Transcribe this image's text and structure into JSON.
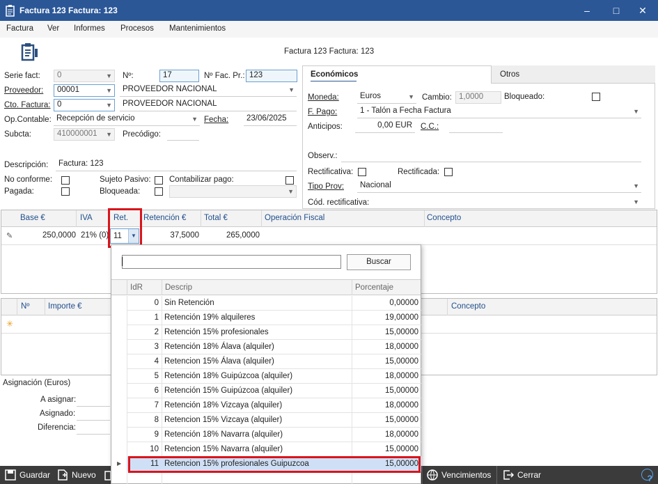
{
  "window": {
    "title": "Factura 123  Factura: 123",
    "minimize": "–",
    "maximize": "□",
    "close": "✕"
  },
  "menu": [
    "Factura",
    "Ver",
    "Informes",
    "Procesos",
    "Mantenimientos"
  ],
  "header": {
    "doc_title": "Factura 123  Factura: 123"
  },
  "form": {
    "serie_label": "Serie fact:",
    "serie_value": "0",
    "num_label": "Nº:",
    "num_value": "17",
    "numfac_label": "Nº Fac. Pr.:",
    "numfac_value": "123",
    "proveedor_label": "Proveedor:",
    "proveedor_code": "00001",
    "proveedor_name": "PROVEEDOR NACIONAL",
    "cto_label": "Cto. Factura:",
    "cto_code": "0",
    "cto_name": "PROVEEDOR NACIONAL",
    "opcontable_label": "Op.Contable:",
    "opcontable_value": "Recepción de servicio",
    "fecha_label": "Fecha:",
    "fecha_value": "23/06/2025",
    "subcta_label": "Subcta:",
    "subcta_value": "410000001",
    "precodigo_label": "Precódigo:",
    "precodigo_value": "",
    "descripcion_label": "Descripción:",
    "descripcion_value": "Factura: 123",
    "noconforme_label": "No conforme:",
    "sujeto_label": "Sujeto Pasivo:",
    "contabilizar_label": "Contabilizar pago:",
    "pagada_label": "Pagada:",
    "bloqueada_label": "Bloqueada:"
  },
  "tabs": {
    "economicos": "Económicos",
    "otros": "Otros"
  },
  "economicos": {
    "moneda_label": "Moneda:",
    "moneda_value": "Euros",
    "cambio_label": "Cambio:",
    "cambio_value": "1,0000",
    "bloqueado_label": "Bloqueado:",
    "fpago_label": "F. Pago:",
    "fpago_value": "1 - Talón a Fecha Factura",
    "anticipos_label": "Anticipos:",
    "anticipos_value": "0,00 EUR",
    "cc_label": "C.C.:",
    "cc_value": "",
    "observ_label": "Observ.:",
    "rectificativa_label": "Rectificativa:",
    "rectificada_label": "Rectificada:",
    "tipoprov_label": "Tipo Prov:",
    "tipoprov_value": "Nacional",
    "codrect_label": "Cód. rectificativa:"
  },
  "grid1": {
    "columns": [
      "Base €",
      "IVA",
      "Ret.",
      "Retención €",
      "Total €",
      "Operación Fiscal",
      "Concepto"
    ],
    "row": {
      "base": "250,0000",
      "iva": "21% (0)",
      "ret": "11",
      "retencion": "37,5000",
      "total": "265,0000"
    }
  },
  "grid2": {
    "columns": [
      "Nº",
      "Importe €",
      "Concepto"
    ]
  },
  "asignacion": {
    "title": "Asignación (Euros)",
    "a_asignar": "A asignar:",
    "asignado": "Asignado:",
    "diferencia": "Diferencia:"
  },
  "popup": {
    "search_value": "",
    "search_button": "Buscar",
    "columns": [
      "IdR",
      "Descrip",
      "Porcentaje"
    ],
    "rows": [
      {
        "idr": "0",
        "desc": "Sin Retención",
        "pct": "0,00000"
      },
      {
        "idr": "1",
        "desc": "Retención 19% alquileres",
        "pct": "19,00000"
      },
      {
        "idr": "2",
        "desc": "Retención 15% profesionales",
        "pct": "15,00000"
      },
      {
        "idr": "3",
        "desc": "Retención 18% Álava (alquiler)",
        "pct": "18,00000"
      },
      {
        "idr": "4",
        "desc": "Retencion 15% Álava (alquiler)",
        "pct": "15,00000"
      },
      {
        "idr": "5",
        "desc": "Retención 18% Guipúzcoa (alquiler)",
        "pct": "18,00000"
      },
      {
        "idr": "6",
        "desc": "Retención 15% Guipúzcoa (alquiler)",
        "pct": "15,00000"
      },
      {
        "idr": "7",
        "desc": "Retención 18% Vizcaya (alquiler)",
        "pct": "18,00000"
      },
      {
        "idr": "8",
        "desc": "Retencion 15% Vizcaya (alquiler)",
        "pct": "15,00000"
      },
      {
        "idr": "9",
        "desc": "Retención 18% Navarra (alquiler)",
        "pct": "18,00000"
      },
      {
        "idr": "10",
        "desc": "Retencion 15% Navarra (alquiler)",
        "pct": "15,00000"
      },
      {
        "idr": "11",
        "desc": "Retencion 15% profesionales Guipuzcoa",
        "pct": "15,00000"
      }
    ]
  },
  "toolbar": {
    "guardar": "Guardar",
    "nuevo": "Nuevo",
    "vencimientos": "Vencimientos",
    "cerrar": "Cerrar",
    "help": "?"
  },
  "colors": {
    "titlebar": "#2b5797",
    "accent": "#1f4e8c",
    "highlight": "#d9141b",
    "selected_row": "#cfe0f6"
  }
}
